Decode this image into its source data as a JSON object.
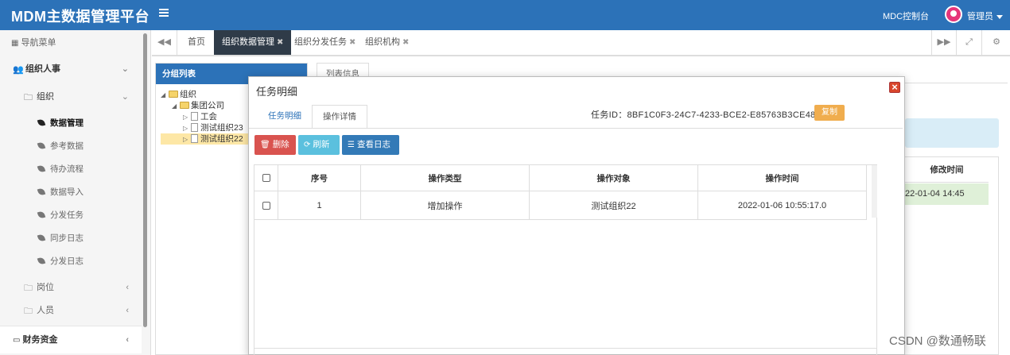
{
  "header": {
    "brand": "MDM主数据管理平台",
    "mdc_link": "MDC控制台",
    "user": "管理员"
  },
  "sidebar": {
    "nav_title": "导航菜单",
    "group1": "组织人事",
    "sub_org": "组织",
    "items": [
      "数据管理",
      "参考数据",
      "待办流程",
      "数据导入",
      "分发任务",
      "同步日志",
      "分发日志"
    ],
    "post": "岗位",
    "person": "人员",
    "finance": "财务资金"
  },
  "tabs": {
    "home": "首页",
    "list": [
      "组织数据管理",
      "组织分发任务",
      "组织机构"
    ]
  },
  "left_panel": {
    "title": "分组列表",
    "tree": [
      "组织",
      "集团公司",
      "工会",
      "测试组织23",
      "测试组织22"
    ]
  },
  "bg": {
    "list_tab": "列表信息",
    "col_modified": "修改时间",
    "cell_modified": "22-01-04 14:45"
  },
  "modal": {
    "title": "任务明细",
    "tab1": "任务明细",
    "tab2": "操作详情",
    "task_id_label": "任务ID：",
    "task_id": "8BF1C0F3-24C7-4233-BCE2-E85763B3CE48",
    "copy": "复制",
    "btn_delete": "删除",
    "btn_refresh": "刷新",
    "btn_log": "查看日志",
    "columns": [
      "序号",
      "操作类型",
      "操作对象",
      "操作时间"
    ],
    "rows": [
      [
        "1",
        "增加操作",
        "测试组织22",
        "2022-01-06 10:55:17.0"
      ]
    ]
  },
  "watermark": "CSDN @数通畅联",
  "colors": {
    "primary": "#2c72b8",
    "active_tab": "#2f3b48",
    "danger": "#d9534f",
    "info": "#5bc0de",
    "warning": "#f0ad4e"
  }
}
